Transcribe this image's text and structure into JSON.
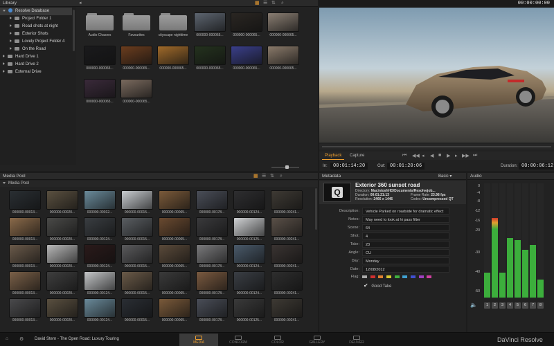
{
  "app": {
    "name": "DaVinci Resolve",
    "project": "David Stern - The Open Road: Luxury Touring"
  },
  "library": {
    "title": "Library",
    "tree": [
      {
        "label": "Resolve Database",
        "level": 0,
        "expanded": true,
        "selected": true
      },
      {
        "label": "Project Folder 1",
        "level": 1
      },
      {
        "label": "Road shots at night",
        "level": 1
      },
      {
        "label": "Exterior Shots",
        "level": 1
      },
      {
        "label": "Lovely Project Folder 4",
        "level": 1
      },
      {
        "label": "On the Road",
        "level": 1
      },
      {
        "label": "Hard Drive 1",
        "level": 0
      },
      {
        "label": "Hard Drive 2",
        "level": 0
      },
      {
        "label": "External Drive",
        "level": 0
      }
    ],
    "items": [
      {
        "label": "Audio Chasers",
        "kind": "folder"
      },
      {
        "label": "Favourites",
        "kind": "folder"
      },
      {
        "label": "cityscape nighttime",
        "kind": "folder"
      },
      {
        "label": "000000-000065...",
        "kind": "clip",
        "color": "#5d6570"
      },
      {
        "label": "000000-000065...",
        "kind": "clip",
        "color": "#2a2622"
      },
      {
        "label": "000000-000065...",
        "kind": "clip",
        "color": "#8a7e72"
      },
      {
        "label": "000000-000065...",
        "kind": "clip",
        "color": "#1a1a1c"
      },
      {
        "label": "000000-000065...",
        "kind": "clip",
        "color": "#6b3d1e"
      },
      {
        "label": "000000-000065...",
        "kind": "clip",
        "color": "#a06a2a"
      },
      {
        "label": "000000-000065...",
        "kind": "clip",
        "color": "#24321e"
      },
      {
        "label": "000000-000065...",
        "kind": "clip",
        "color": "#3a3f8a"
      },
      {
        "label": "000000-000065...",
        "kind": "clip",
        "color": "#8a7a6a"
      },
      {
        "label": "000000-000065...",
        "kind": "clip",
        "color": "#3a2a3a"
      },
      {
        "label": "000000-000065...",
        "kind": "clip",
        "color": "#7a6a5e"
      }
    ]
  },
  "viewer": {
    "timecode": "00:00:00:00",
    "tabs": [
      "Playback",
      "Capture"
    ],
    "in_label": "In:",
    "in_tc": "00:01:14:20",
    "out_label": "Out:",
    "out_tc": "00:01:20:06",
    "duration_label": "Duration:",
    "duration_tc": "00:00:06:12"
  },
  "media_pool": {
    "title": "Media Pool",
    "root": "Media Pool",
    "rows": [
      [
        {
          "label": "000000-00013...",
          "color": "#2a2f33"
        },
        {
          "label": "000000-00020...",
          "color": "#5a5040"
        },
        {
          "label": "000000-00012...",
          "color": "#6a8a9a"
        },
        {
          "label": "000000-00015...",
          "color": "#c8ccd0"
        },
        {
          "label": "000000-00065...",
          "color": "#7a5a3a"
        },
        {
          "label": "000000-00178...",
          "color": "#4a4e58"
        },
        {
          "label": "000000-00124...",
          "color": "#2e2e30"
        },
        {
          "label": "000000-00241...",
          "color": "#3e3a34"
        }
      ],
      [
        {
          "label": "000000-00013...",
          "color": "#8a6a4a"
        },
        {
          "label": "000000-00020...",
          "color": "#4a4a48"
        },
        {
          "label": "000000-00124...",
          "color": "#3a3e42"
        },
        {
          "label": "000000-00015...",
          "color": "#5a5e62"
        },
        {
          "label": "000000-00065...",
          "color": "#6a4a30"
        },
        {
          "label": "000000-00178...",
          "color": "#3a3a3c"
        },
        {
          "label": "000000-00125...",
          "color": "#d0d2d4"
        },
        {
          "label": "000000-00241...",
          "color": "#5a5048"
        }
      ],
      [
        {
          "label": "000000-00013...",
          "color": "#6a5a4a"
        },
        {
          "label": "000000-00020...",
          "color": "#b8b8b8"
        },
        {
          "label": "000000-00124...",
          "color": "#2a1a1a"
        },
        {
          "label": "000000-00015...",
          "color": "#5a5a5c"
        },
        {
          "label": "000000-00065...",
          "color": "#5a4a3a"
        },
        {
          "label": "000000-00178...",
          "color": "#7a7a7c"
        },
        {
          "label": "000000-00124...",
          "color": "#4a5a6a"
        },
        {
          "label": "000000-00241...",
          "color": "#3a3432"
        }
      ],
      [
        {
          "label": "000000-00013...",
          "color": "#7a6048"
        },
        {
          "label": "000000-00020...",
          "color": "#3e3e3e"
        },
        {
          "label": "000000-00124...",
          "color": "#c4c6c8"
        },
        {
          "label": "000000-00015...",
          "color": "#6a5a48"
        },
        {
          "label": "000000-00065...",
          "color": "#3a3a3a"
        },
        {
          "label": "000000-00178...",
          "color": "#7a5a40"
        },
        {
          "label": "000000-00124...",
          "color": "#3a3e44"
        },
        {
          "label": "000000-00241...",
          "color": "#2e2e2e"
        }
      ],
      [
        {
          "label": "000000-00013...",
          "color": "#4a4a4c"
        },
        {
          "label": "000000-00020...",
          "color": "#5a5040"
        },
        {
          "label": "000000-00124...",
          "color": "#6a8a9a"
        },
        {
          "label": "000000-00015...",
          "color": "#2a2e34"
        },
        {
          "label": "000000-00065...",
          "color": "#7a5a3a"
        },
        {
          "label": "000000-00178...",
          "color": "#4a4e58"
        },
        {
          "label": "000000-00125...",
          "color": "#3a3a3a"
        },
        {
          "label": "000000-00241...",
          "color": "#3e3a34"
        }
      ]
    ]
  },
  "metadata": {
    "title": "Metadata",
    "mode": "Basic",
    "clip_name": "Exterior 360 sunset road",
    "directory_label": "Directory:",
    "directory": "MacintoshHD/Documents/Resolvejob...",
    "duration_label": "Duration:",
    "duration": "00:01:21:13",
    "framerate_label": "Frame Rate:",
    "framerate": "23.98 fps",
    "resolution_label": "Resolution:",
    "resolution": "2466 x 1446",
    "codec_label": "Codec:",
    "codec": "Uncompressed QT",
    "fields": [
      {
        "label": "Description:",
        "value": "Vehicle Parked on roadside for dramatic effect"
      },
      {
        "label": "Notes:",
        "value": "May need to look at hi pass filter"
      },
      {
        "label": "Scene:",
        "value": "64"
      },
      {
        "label": "Shot:",
        "value": "4"
      },
      {
        "label": "Take:",
        "value": "23"
      },
      {
        "label": "Angle:",
        "value": "CU"
      },
      {
        "label": "Day:",
        "value": "Monday"
      },
      {
        "label": "Date:",
        "value": "12/08/2012"
      }
    ],
    "flag_label": "Flag:",
    "good_take_label": "Good Take"
  },
  "audio": {
    "title": "Audio",
    "scale": [
      "0",
      "-4",
      "-8",
      "-12",
      "-16",
      "-20",
      "-30",
      "-40",
      "-50"
    ],
    "levels": [
      0.22,
      0.7,
      0.22,
      0.52,
      0.5,
      0.42,
      0.46,
      0.16
    ],
    "channels": [
      "1",
      "2",
      "3",
      "4",
      "5",
      "6",
      "7",
      "8"
    ]
  },
  "pages": [
    {
      "label": "MEDIA",
      "active": true
    },
    {
      "label": "CONFORM",
      "active": false
    },
    {
      "label": "COLOR",
      "active": false
    },
    {
      "label": "GALLERY",
      "active": false
    },
    {
      "label": "DELIVER",
      "active": false
    }
  ],
  "colors": {
    "accent": "#f0a030",
    "meter": "#3cae3c",
    "peak": "#d23a2a"
  }
}
